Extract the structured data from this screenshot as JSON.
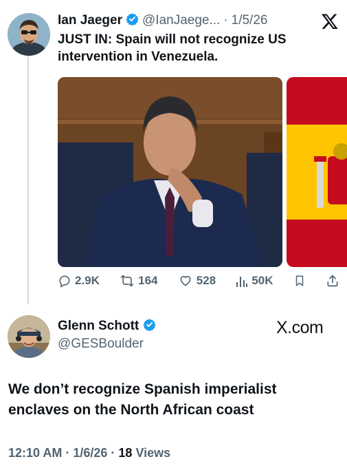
{
  "tweet": {
    "author_name": "Ian Jaeger",
    "author_handle": "@IanJaege...",
    "date_separator": "·",
    "date": "1/5/26",
    "text_line1": "JUST IN: Spain will not recognize US",
    "text_line2": "intervention in Venezuela.",
    "stats": {
      "replies": "2.9K",
      "retweets": "164",
      "likes": "528",
      "views": "50K"
    },
    "icons": [
      "verified-badge-icon",
      "x-logo-icon",
      "reply-icon",
      "retweet-icon",
      "like-icon",
      "views-icon",
      "bookmark-icon",
      "share-icon"
    ]
  },
  "reply": {
    "author_name": "Glenn Schott",
    "author_handle": "@GESBoulder",
    "source": "X.com",
    "text_line1": "We don’t recognize Spanish imperialist",
    "text_line2": "enclaves on the North African coast",
    "time": "12:10 AM",
    "sep1": "·",
    "date": "1/6/26",
    "sep2": "·",
    "views_count": "18",
    "views_label": "Views"
  },
  "colors": {
    "verified_blue": "#1d9bf0",
    "secondary_text": "#536471",
    "primary_text": "#0f1419",
    "flag_red": "#c60b1e",
    "flag_yellow": "#ffc400"
  }
}
